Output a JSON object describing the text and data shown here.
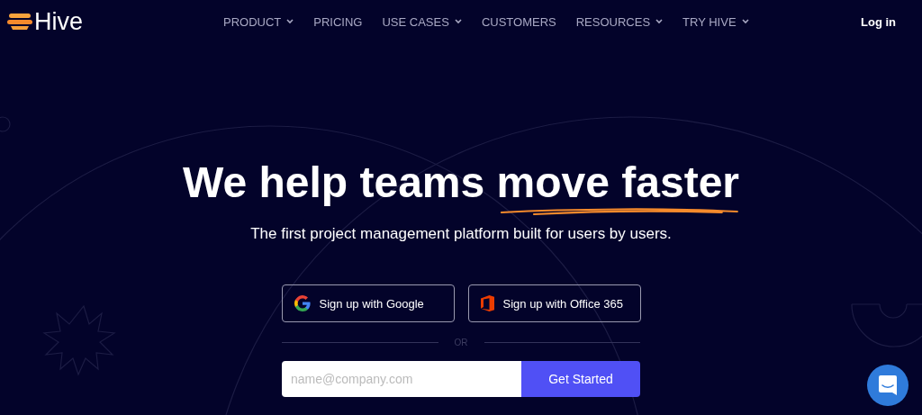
{
  "brand": {
    "name": "Hive"
  },
  "nav": [
    {
      "label": "PRODUCT",
      "dropdown": true
    },
    {
      "label": "PRICING",
      "dropdown": false
    },
    {
      "label": "USE CASES",
      "dropdown": true
    },
    {
      "label": "CUSTOMERS",
      "dropdown": false
    },
    {
      "label": "RESOURCES",
      "dropdown": true
    },
    {
      "label": "TRY HIVE",
      "dropdown": true
    }
  ],
  "login": "Log in",
  "hero": {
    "headline": "We help teams",
    "highlight": "move faster",
    "subtitle": "The first project management platform built for users by users."
  },
  "signup_buttons": [
    {
      "kind": "google",
      "label": "Sign up with Google"
    },
    {
      "kind": "office",
      "label": "Sign up with Office 365"
    }
  ],
  "divider": "OR",
  "email": {
    "placeholder": "name@company.com",
    "button": "Get Started"
  }
}
